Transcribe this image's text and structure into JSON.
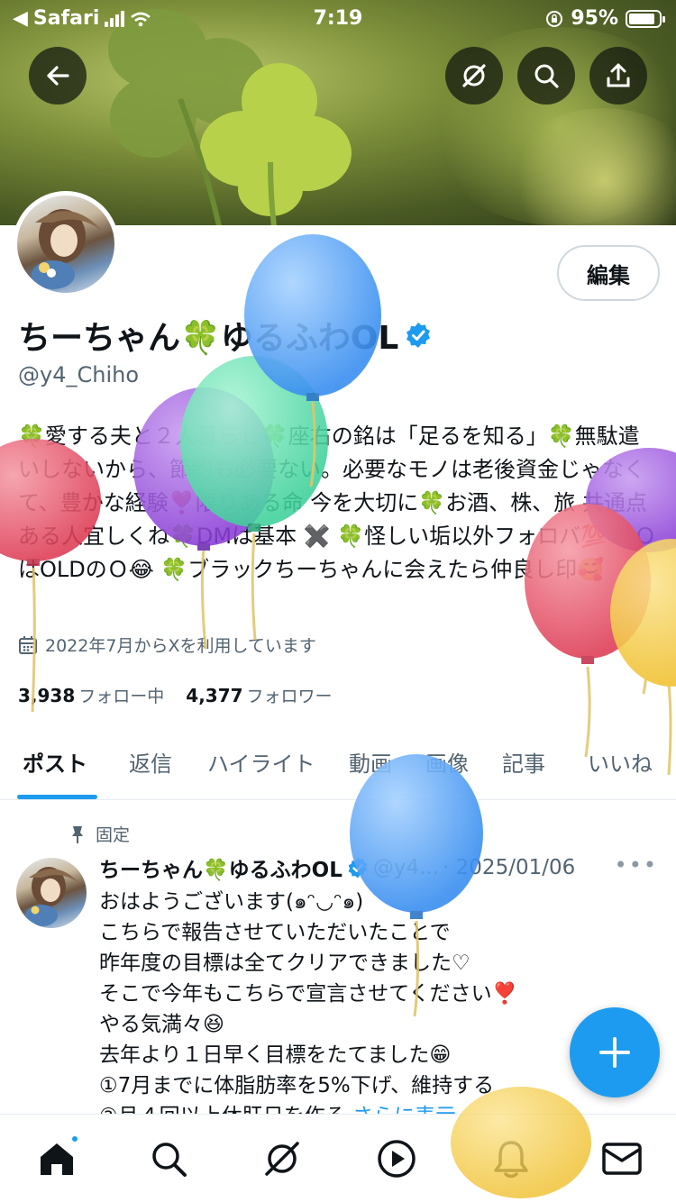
{
  "status_bar": {
    "back_app": "Safari",
    "time": "7:19",
    "battery": "95%"
  },
  "profile": {
    "edit_label": "編集",
    "display_name": "ちーちゃん🍀ゆるふわOL",
    "handle": "@y4_Chiho",
    "bio": "🍀愛する夫と２人暮らし🍀座右の銘は「足るを知る」🍀無駄遣いしないから、節約も必要ない。必要なモノは老後資金じゃなくて、豊かな経験❣️限りある命 今を大切に🍀お酒、株、旅 共通点ある人宜しくね🍀DMは基本 ✖️ 🍀怪しい垢以外フォロバ💯🍀ＯはOLDのＯ😂 🍀ブラックちーちゃんに会えたら仲良し印🥰",
    "joined": "2022年7月からXを利用しています",
    "following_count": "3,938",
    "following_label": "フォロー中",
    "followers_count": "4,377",
    "followers_label": "フォロワー"
  },
  "tabs": [
    "ポスト",
    "返信",
    "ハイライト",
    "動画",
    "画像",
    "記事",
    "いいね"
  ],
  "post": {
    "pinned_label": "固定",
    "name": "ちーちゃん🍀ゆるふわOL",
    "handle": "@y4...",
    "date": "· 2025/01/06",
    "lines": [
      "おはようございます(๑ᵔ◡ᵔ๑)",
      "こちらで報告させていただいたことで",
      "昨年度の目標は全てクリアできました♡",
      "そこで今年もこちらで宣言させてください❣️",
      "やる気満々😆",
      "去年より１日早く目標をたてました😁",
      "①7月までに体脂肪率を5%下げ、維持する",
      "②月４回以上休肝日を作る"
    ],
    "show_more": "さらに表示"
  },
  "icons": {
    "back": "arrow-left-icon",
    "grok": "grok-icon",
    "search": "search-icon",
    "share": "share-icon",
    "verified": "verified-badge-icon",
    "calendar": "calendar-icon",
    "pin": "pin-icon",
    "compose": "plus-icon",
    "nav": [
      "home-icon",
      "search-icon",
      "grok-icon",
      "video-play-icon",
      "bell-icon",
      "mail-icon"
    ]
  },
  "colors": {
    "accent": "#1d9bf0",
    "text": "#0f1419",
    "muted": "#536471"
  }
}
